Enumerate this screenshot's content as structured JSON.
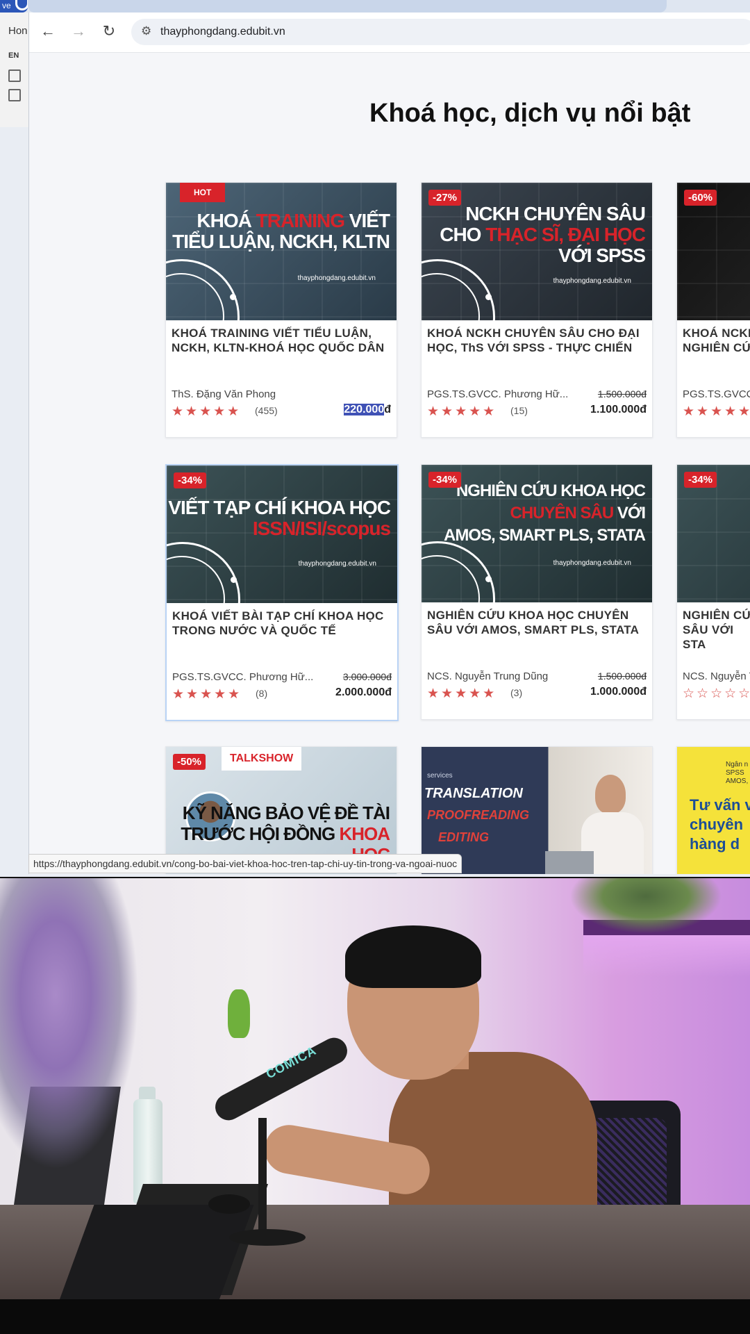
{
  "tabstrip": {
    "active_tab_label": "ve"
  },
  "background_window": {
    "home_label": "Hon",
    "lang_label": "EN"
  },
  "browser": {
    "url": "thayphongdang.edubit.vn",
    "status_url": "https://thayphongdang.edubit.vn/cong-bo-bai-viet-khoa-hoc-tren-tap-chi-uy-tin-trong-va-ngoai-nuoc"
  },
  "page": {
    "title": "Khoá học, dịch vụ nổi bật",
    "cards": [
      {
        "badge": "HOT",
        "thumb_lines": [
          "KHOÁ ",
          "TRAINING",
          " VIẾT",
          "TIỂU LUẬN, NCKH, KLTN"
        ],
        "thumb_site": "thayphongdang.edubit.vn",
        "title": "KHOÁ TRAINING VIẾT TIỂU LUẬN, NCKH, KLTN-KHOÁ HỌC QUỐC DÂN",
        "author": "ThS. Đặng Văn Phong",
        "old_price": "",
        "reviews": "(455)",
        "rating": 5,
        "price_highlight": "220.000",
        "price_suffix": "đ"
      },
      {
        "badge": "-27%",
        "thumb_lines": [
          "NCKH CHUYÊN SÂU",
          "CHO ",
          "THẠC SĨ, ĐẠI HỌC",
          "VỚI SPSS"
        ],
        "thumb_site": "thayphongdang.edubit.vn",
        "title": "KHOÁ NCKH CHUYÊN SÂU CHO ĐẠI HỌC, ThS VỚI SPSS - THỰC CHIẾN",
        "author": "PGS.TS.GVCC. Phương Hữ...",
        "old_price": "1.500.000đ",
        "reviews": "(15)",
        "rating": 5,
        "price": "1.100.000đ"
      },
      {
        "badge": "-60%",
        "title": "KHOÁ NCKH NGHIÊN CỨ",
        "author": "PGS.TS.GVCC. P",
        "rating": 4
      },
      {
        "badge": "-34%",
        "thumb_lines": [
          "VIẾT TẠP CHÍ KHOA HỌC",
          "ISSN/ISI/scopus"
        ],
        "thumb_site": "thayphongdang.edubit.vn",
        "title": "KHOÁ VIẾT BÀI TẠP CHÍ KHOA HỌC TRONG NƯỚC VÀ QUỐC TẾ",
        "author": "PGS.TS.GVCC. Phương Hữ...",
        "old_price": "3.000.000đ",
        "reviews": "(8)",
        "rating": 5,
        "price": "2.000.000đ"
      },
      {
        "badge": "-34%",
        "thumb_lines": [
          "NGHIÊN CỨU KHOA HỌC",
          "CHUYÊN SÂU",
          " VỚI",
          "AMOS, SMART PLS, STATA"
        ],
        "thumb_site": "thayphongdang.edubit.vn",
        "title": "NGHIÊN CỨU KHOA HỌC CHUYÊN SÂU VỚI AMOS, SMART PLS, STATA",
        "author": "NCS. Nguyễn Trung Dũng",
        "old_price": "1.500.000đ",
        "reviews": "(3)",
        "rating": 5,
        "price": "1.000.000đ"
      },
      {
        "badge": "-34%",
        "title": "NGHIÊN CỨ SÂU VỚI STA",
        "author": "NCS. Nguyễn T",
        "rating": 0
      },
      {
        "badge": "-50%",
        "tag": "TALKSHOW",
        "thumb_lines": [
          "KỸ NĂNG BẢO VỆ ĐỀ TÀI",
          "TRƯỚC HỘI ĐỒNG ",
          "KHOA HỌC"
        ]
      },
      {
        "thumb_lines": [
          "services",
          "TRANSLATION",
          "PROOFREADING",
          "EDITING"
        ]
      },
      {
        "thumb_lines": [
          "Ngân n",
          "SPSS",
          "AMOS,",
          "Tư vấn v",
          "chuyên",
          "hàng d"
        ]
      }
    ]
  },
  "webcam": {
    "mic_brand": "COMICA"
  },
  "colors": {
    "badge_red": "#d8232a",
    "star_red": "#d9534f",
    "selection_blue": "#3f51b5"
  }
}
